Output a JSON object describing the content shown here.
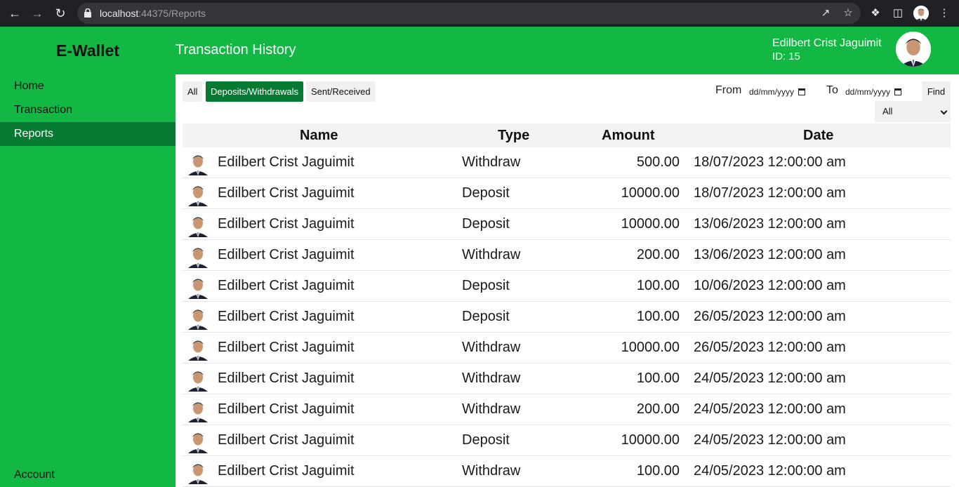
{
  "browser": {
    "url_host": "localhost",
    "url_rest": ":44375/Reports"
  },
  "app": {
    "brand": "E-Wallet",
    "page_title": "Transaction History",
    "user_name": "Edilbert Crist Jaguimit",
    "user_id_label": "ID:",
    "user_id": "15",
    "accent": "#12b843",
    "accent_dark": "#067a32"
  },
  "sidebar": {
    "items": [
      {
        "label": "Home"
      },
      {
        "label": "Transaction"
      },
      {
        "label": "Reports"
      }
    ],
    "bottom_item": "Account"
  },
  "filters": {
    "all": "All",
    "deposits_withdrawals": "Deposits/Withdrawals",
    "sent_received": "Sent/Received",
    "from_label": "From",
    "to_label": "To",
    "from_value": "dd/mm/yyyy",
    "to_value": "dd/mm/yyyy",
    "find": "Find",
    "type_selected": "All"
  },
  "table": {
    "headers": {
      "name": "Name",
      "type": "Type",
      "amount": "Amount",
      "date": "Date"
    },
    "rows": [
      {
        "name": "Edilbert Crist Jaguimit",
        "type": "Withdraw",
        "amount": "500.00",
        "date": "18/07/2023 12:00:00 am"
      },
      {
        "name": "Edilbert Crist Jaguimit",
        "type": "Deposit",
        "amount": "10000.00",
        "date": "18/07/2023 12:00:00 am"
      },
      {
        "name": "Edilbert Crist Jaguimit",
        "type": "Deposit",
        "amount": "10000.00",
        "date": "13/06/2023 12:00:00 am"
      },
      {
        "name": "Edilbert Crist Jaguimit",
        "type": "Withdraw",
        "amount": "200.00",
        "date": "13/06/2023 12:00:00 am"
      },
      {
        "name": "Edilbert Crist Jaguimit",
        "type": "Deposit",
        "amount": "100.00",
        "date": "10/06/2023 12:00:00 am"
      },
      {
        "name": "Edilbert Crist Jaguimit",
        "type": "Deposit",
        "amount": "100.00",
        "date": "26/05/2023 12:00:00 am"
      },
      {
        "name": "Edilbert Crist Jaguimit",
        "type": "Withdraw",
        "amount": "10000.00",
        "date": "26/05/2023 12:00:00 am"
      },
      {
        "name": "Edilbert Crist Jaguimit",
        "type": "Withdraw",
        "amount": "100.00",
        "date": "24/05/2023 12:00:00 am"
      },
      {
        "name": "Edilbert Crist Jaguimit",
        "type": "Withdraw",
        "amount": "200.00",
        "date": "24/05/2023 12:00:00 am"
      },
      {
        "name": "Edilbert Crist Jaguimit",
        "type": "Deposit",
        "amount": "10000.00",
        "date": "24/05/2023 12:00:00 am"
      },
      {
        "name": "Edilbert Crist Jaguimit",
        "type": "Withdraw",
        "amount": "100.00",
        "date": "24/05/2023 12:00:00 am"
      }
    ]
  }
}
